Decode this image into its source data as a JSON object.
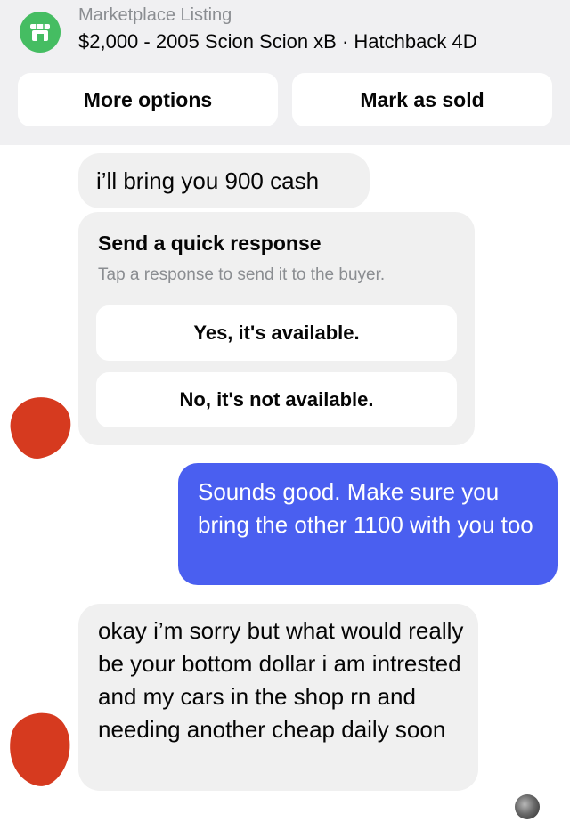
{
  "header": {
    "kicker": "Marketplace Listing",
    "title": "$2,000 - 2005 Scion Scion xB · Hatchback 4D",
    "store_icon": "storefront-icon",
    "accent_color": "#45bd62",
    "buttons": {
      "more_options": "More options",
      "mark_as_sold": "Mark as sold"
    }
  },
  "messages": [
    {
      "from": "buyer",
      "text": "i’ll bring you 900 cash"
    },
    {
      "from": "seller",
      "text": "Sounds good. Make sure you bring the other 1100 with you too"
    },
    {
      "from": "buyer",
      "text": "okay i’m sorry but what would really be your bottom dollar i am intrested and my cars in the shop rn and needing another cheap daily soon"
    }
  ],
  "quick_response": {
    "title": "Send a quick response",
    "subtitle": "Tap a response to send it to the buyer.",
    "options": [
      "Yes, it's available.",
      "No, it's not available."
    ]
  },
  "colors": {
    "sent_bubble": "#4a5ff0",
    "received_bubble": "#f0f0f0",
    "redaction": "#d63a1f"
  }
}
